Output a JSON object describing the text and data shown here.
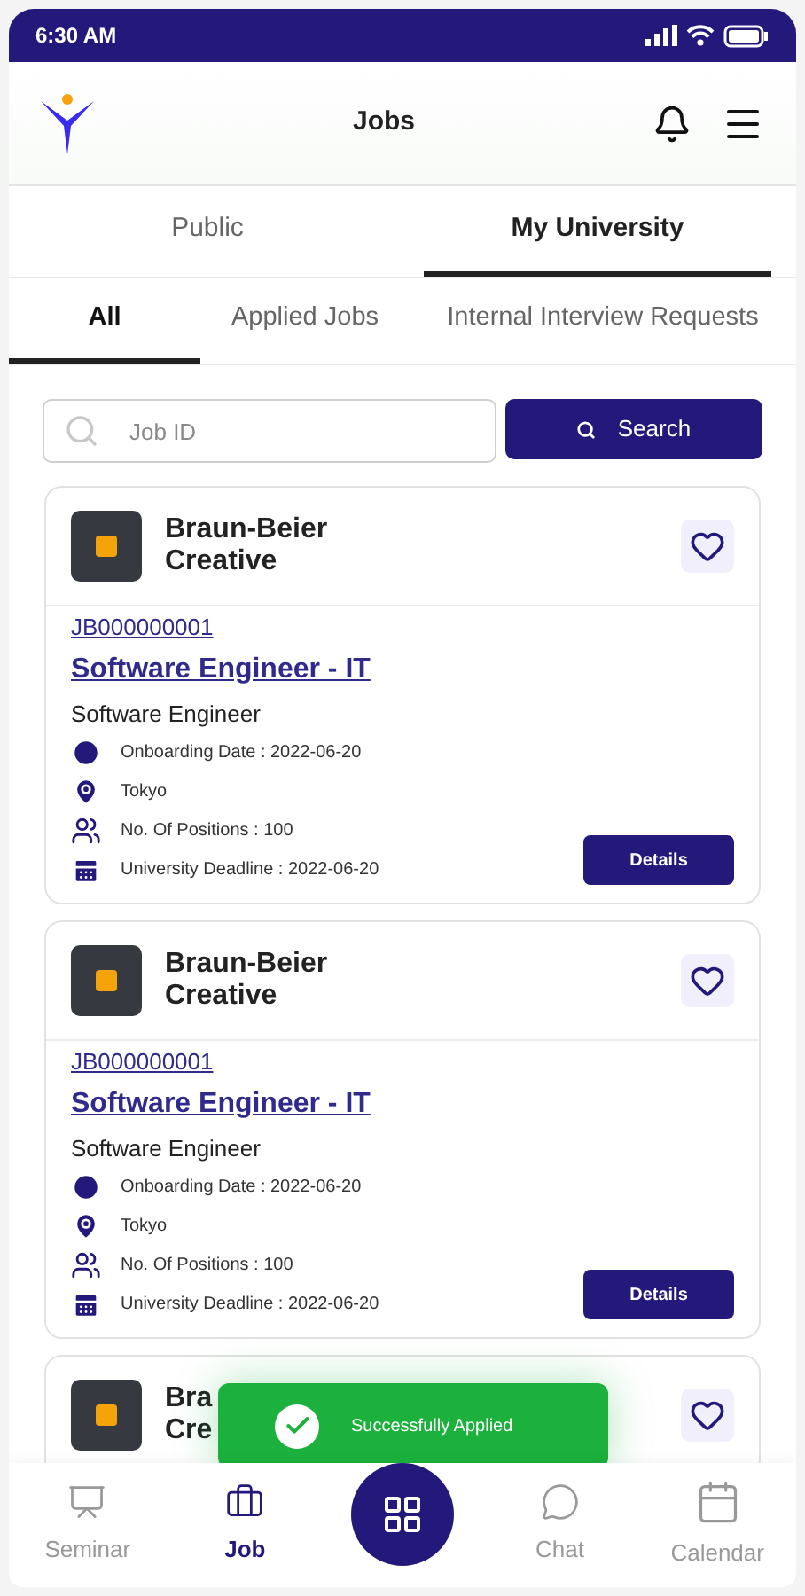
{
  "status_bar": {
    "time": "6:30 AM"
  },
  "header": {
    "title": "Jobs"
  },
  "tabs": [
    {
      "label": "Public",
      "selected": false
    },
    {
      "label": "My University",
      "selected": true
    }
  ],
  "sub_tabs": [
    {
      "label": "All",
      "selected": true
    },
    {
      "label": "Applied Jobs",
      "selected": false
    },
    {
      "label": "Internal Interview Requests",
      "selected": false
    }
  ],
  "search": {
    "placeholder": "Job ID",
    "button": "Search"
  },
  "jobs": [
    {
      "company_lines": [
        "Braun-Beier",
        "Creative"
      ],
      "job_id": "JB000000001",
      "title": "Software Engineer - IT",
      "role": "Software Engineer",
      "onboarding": "Onboarding Date : 2022-06-20",
      "location": "Tokyo",
      "positions": "No. Of Positions : 100",
      "deadline": "University Deadline : 2022-06-20",
      "button": "Details"
    },
    {
      "company_lines": [
        "Braun-Beier",
        "Creative"
      ],
      "job_id": "JB000000001",
      "title": "Software Engineer - IT",
      "role": "Software Engineer",
      "onboarding": "Onboarding Date : 2022-06-20",
      "location": "Tokyo",
      "positions": "No. Of Positions : 100",
      "deadline": "University Deadline : 2022-06-20",
      "button": "Details"
    },
    {
      "company_lines": [
        "Bra",
        "Cre"
      ]
    }
  ],
  "toast": {
    "message": "Successfully Applied"
  },
  "bottom_nav": [
    {
      "kind": "tab",
      "label": "Seminar",
      "selected": false
    },
    {
      "kind": "tab",
      "label": "Job",
      "selected": true
    },
    {
      "kind": "center",
      "selected": false
    },
    {
      "kind": "tab",
      "label": "Chat",
      "selected": false
    },
    {
      "kind": "tab",
      "label": "Calendar",
      "selected": false
    }
  ]
}
